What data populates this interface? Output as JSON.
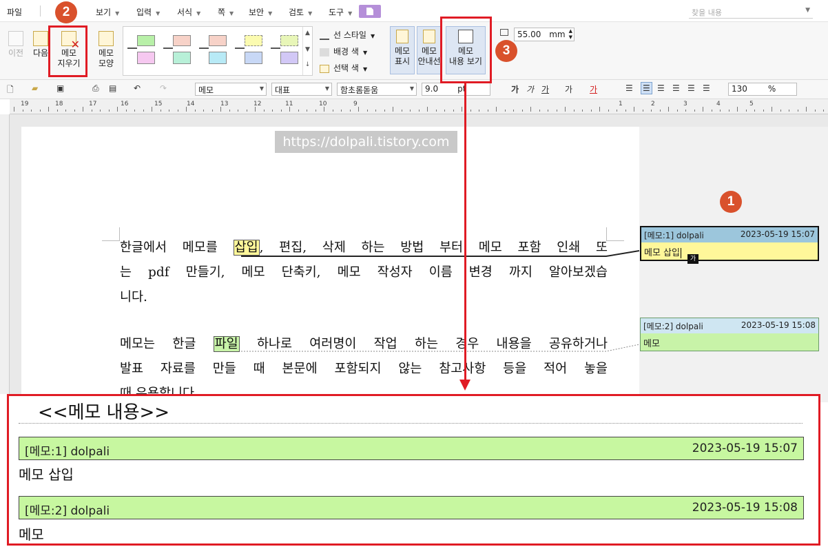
{
  "menubar": {
    "file": "파일",
    "items": [
      "보기",
      "입력",
      "서식",
      "쪽",
      "보안",
      "검토",
      "도구"
    ],
    "search_placeholder": "찾을 내용"
  },
  "ribbon": {
    "prev": "이전",
    "next": "다음",
    "delete_memo_1": "메모",
    "delete_memo_2": "지우기",
    "memo_shape_1": "메모",
    "memo_shape_2": "모양",
    "line_style": "선 스타일",
    "bg_color": "배경 색",
    "select_color": "선택 색",
    "memo_show_1": "메모",
    "memo_show_2": "표시",
    "memo_guide_1": "메모",
    "memo_guide_2": "안내선",
    "memo_view_1": "메모",
    "memo_view_2": "내용 보기",
    "width_value": "55.00",
    "width_unit": "mm"
  },
  "format": {
    "style": "메모",
    "font_group": "대표",
    "font": "함초롬돋움",
    "size": "9.0",
    "size_unit": "pt",
    "zoom": "130",
    "zoom_unit": "%"
  },
  "ruler": {
    "numbers": [
      "19",
      "18",
      "17",
      "16",
      "15",
      "14",
      "13",
      "12",
      "11",
      "10",
      "9",
      "1",
      "2",
      "3",
      "4",
      "5"
    ]
  },
  "doc": {
    "watermark": "https://dolpali.tistory.com",
    "p1_a": "한글에서 메모를 ",
    "p1_hl": "삽입",
    "p1_b": ", 편집, 삭제 하는 방법 부터 메모 포함 인쇄 또",
    "p1_line2": "는 pdf 만들기, 메모 단축키, 메모 작성자 이름 변경 까지 알아보겠습",
    "p1_line3": "니다.",
    "p2_a": "메모는 한글 ",
    "p2_hl": "파일",
    "p2_b": " 하나로 여러명이 작업 하는 경우 내용을 공유하거나",
    "p2_line2": "발표 자료를 만들 때 본문에 포함되지 않는 참고사항 등을 적어 놓을",
    "p2_line3": "때 유용합니다."
  },
  "memos": [
    {
      "label": "[메모:1] dolpali",
      "date": "2023-05-19 15:07",
      "text": "메모 삽입"
    },
    {
      "label": "[메모:2] dolpali",
      "date": "2023-05-19 15:08",
      "text": "메모"
    }
  ],
  "cursor_char": "가",
  "bottom": {
    "title": "<<메모 내용>>"
  },
  "badges": {
    "one": "1",
    "two": "2",
    "three": "3"
  },
  "colors": {
    "accent_red": "#e01b24",
    "badge": "#d9512c",
    "memo_yellow": "#fff79a",
    "memo_green": "#c8f3a8"
  }
}
